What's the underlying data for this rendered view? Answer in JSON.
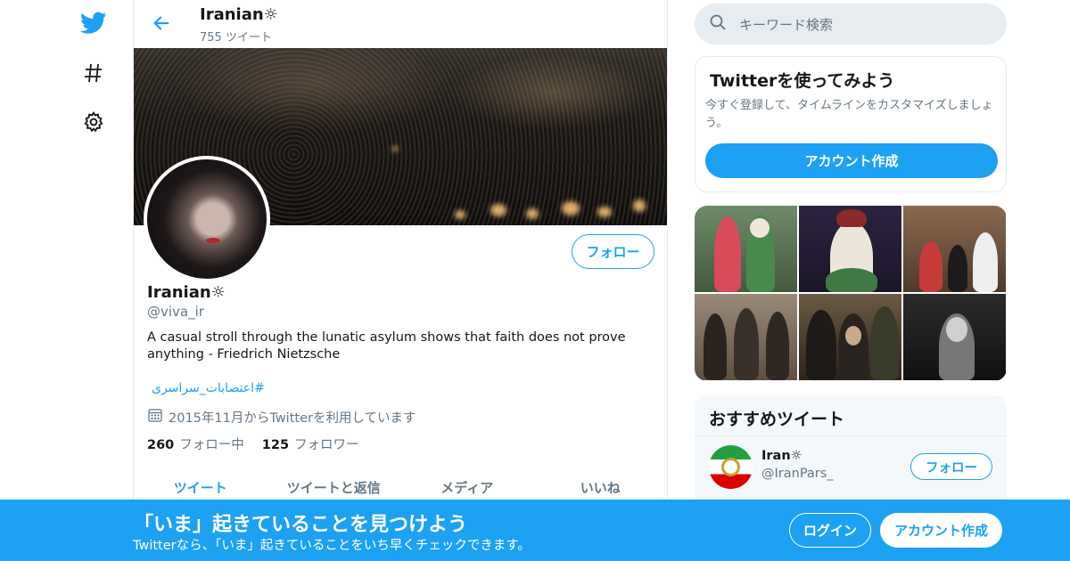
{
  "colors": {
    "accent": "#1da1f2",
    "secondary_text": "#657786",
    "border": "#e6ecf0"
  },
  "nav": {
    "items": [
      {
        "icon": "twitter-bird-icon"
      },
      {
        "icon": "hashtag-icon"
      },
      {
        "icon": "gear-icon"
      }
    ]
  },
  "header": {
    "name": "Iranian☼⁣",
    "tweet_count": "755 ツイート"
  },
  "profile": {
    "follow_label": "フォロー",
    "name": "Iranian☼⁣",
    "handle": "@viva_ir",
    "bio": "A casual stroll through the lunatic asylum shows that faith does not prove anything - Friedrich Nietzsche",
    "hashtag": "#اعتصابات_سراسری",
    "joined": "2015年11月からTwitterを利用しています",
    "following_count": "260",
    "following_label": "フォロー中",
    "followers_count": "125",
    "followers_label": "フォロワー"
  },
  "tabs": [
    "ツイート",
    "ツイートと返信",
    "メディア",
    "いいね"
  ],
  "search": {
    "placeholder": "キーワード検索"
  },
  "signup_card": {
    "title": "Twitterを使ってみよう",
    "subtitle": "今すぐ登録して、タイムラインをカスタマイズしましょう。",
    "button": "アカウント作成"
  },
  "recommended": {
    "title": "おすすめツイート",
    "user_name": "Iran☼⁣",
    "user_handle": "@IranPars_",
    "follow_label": "フォロー"
  },
  "bottom_bar": {
    "title": "「いま」起きていることを見つけよう",
    "subtitle": "Twitterなら、「いま」起きていることをいち早くチェックできます。",
    "login": "ログイン",
    "signup": "アカウント作成"
  }
}
